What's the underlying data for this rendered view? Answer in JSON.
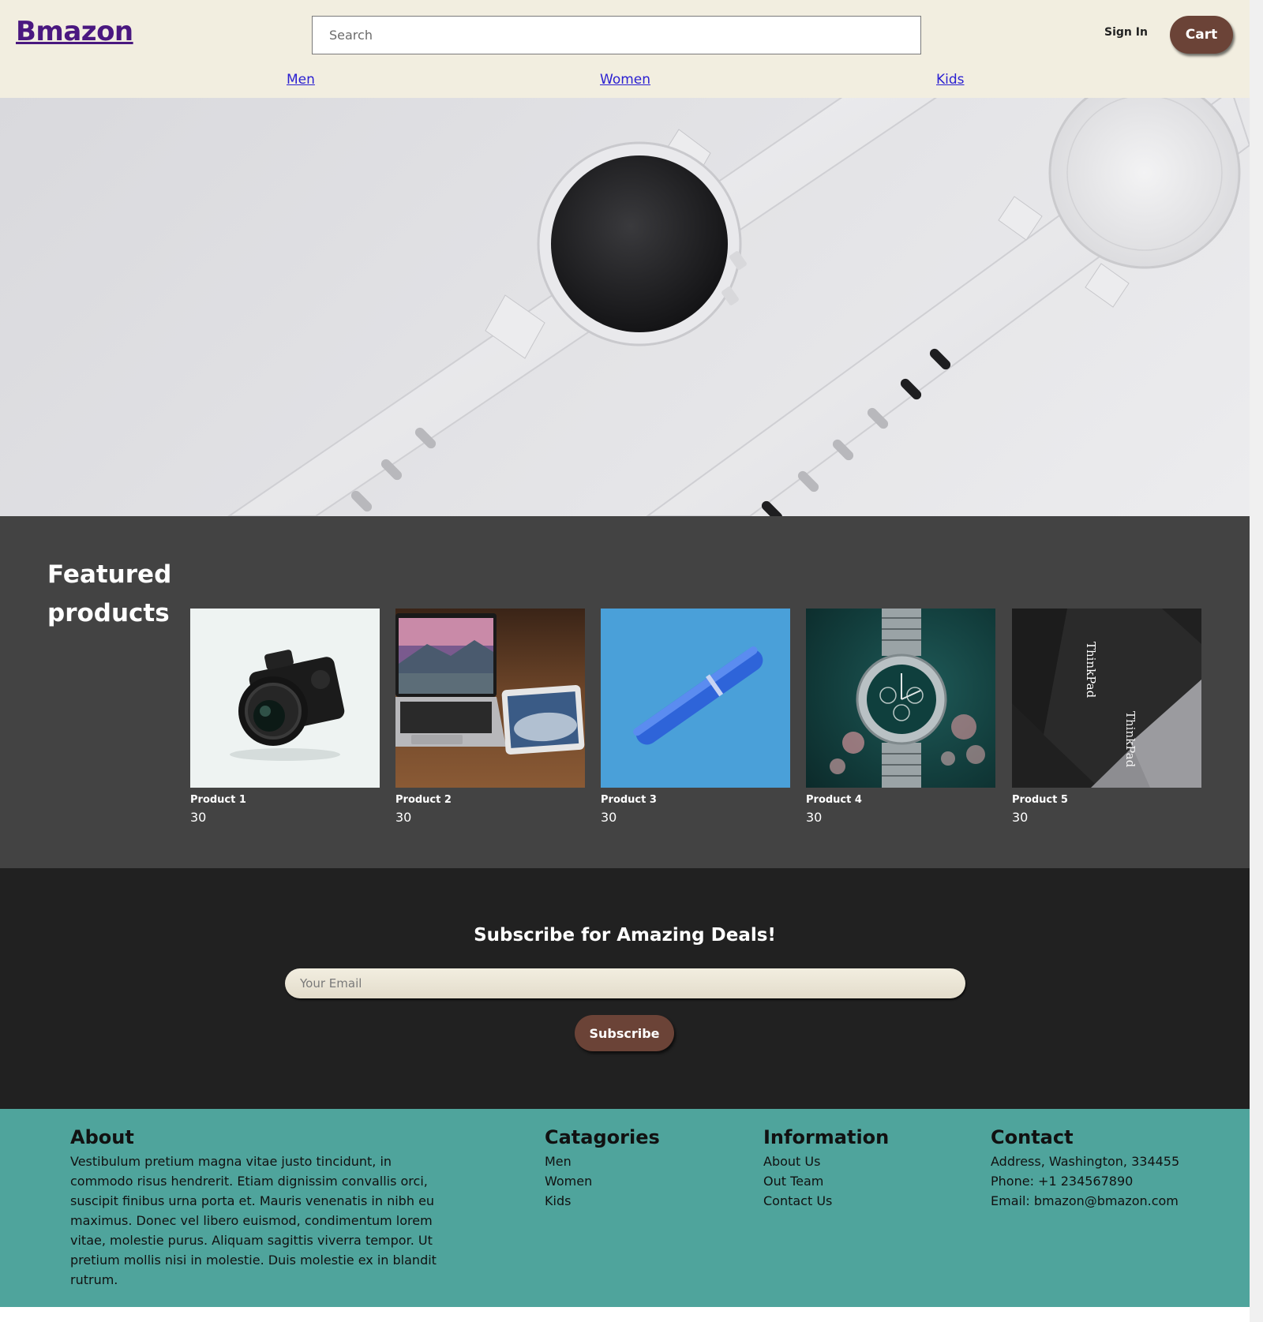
{
  "header": {
    "logo": "Bmazon",
    "search_placeholder": "Search",
    "sign_in_label": "Sign In",
    "cart_label": "Cart",
    "nav": [
      {
        "label": "Men"
      },
      {
        "label": "Women"
      },
      {
        "label": "Kids"
      }
    ]
  },
  "hero": {
    "image": "smartwatch-banner"
  },
  "featured": {
    "title": "Featured products",
    "products": [
      {
        "name": "Product 1",
        "price": "30",
        "image": "camera-photo"
      },
      {
        "name": "Product 2",
        "price": "30",
        "image": "laptop-tablet-photo"
      },
      {
        "name": "Product 3",
        "price": "30",
        "image": "pen-photo"
      },
      {
        "name": "Product 4",
        "price": "30",
        "image": "wristwatch-photo"
      },
      {
        "name": "Product 5",
        "price": "30",
        "image": "thinkpad-photo"
      }
    ],
    "thinkpad_text": "ThinkPad"
  },
  "subscribe": {
    "title": "Subscribe for Amazing Deals!",
    "email_placeholder": "Your Email",
    "button_label": "Subscribe"
  },
  "footer": {
    "about": {
      "heading": "About",
      "text": "Vestibulum pretium magna vitae justo tincidunt, in commodo risus hendrerit. Etiam dignissim convallis orci, suscipit finibus urna porta et. Mauris venenatis in nibh eu maximus. Donec vel libero euismod, condimentum lorem vitae, molestie purus. Aliquam sagittis viverra tempor. Ut pretium mollis nisi in molestie. Duis molestie ex in blandit rutrum."
    },
    "categories": {
      "heading": "Catagories",
      "items": [
        "Men",
        "Women",
        "Kids"
      ]
    },
    "information": {
      "heading": "Information",
      "items": [
        "About Us",
        "Out Team",
        "Contact Us"
      ]
    },
    "contact": {
      "heading": "Contact",
      "items": [
        "Address, Washington, 334455",
        "Phone: +1 234567890",
        "Email: bmazon@bmazon.com"
      ]
    }
  },
  "colors": {
    "header_bg": "#f2eee0",
    "logo": "#4a1880",
    "button_brown": "#6b4337",
    "featured_bg": "#434343",
    "subscribe_bg": "#212121",
    "footer_bg": "#4fa49c",
    "nav_link": "#2a1fd1"
  }
}
